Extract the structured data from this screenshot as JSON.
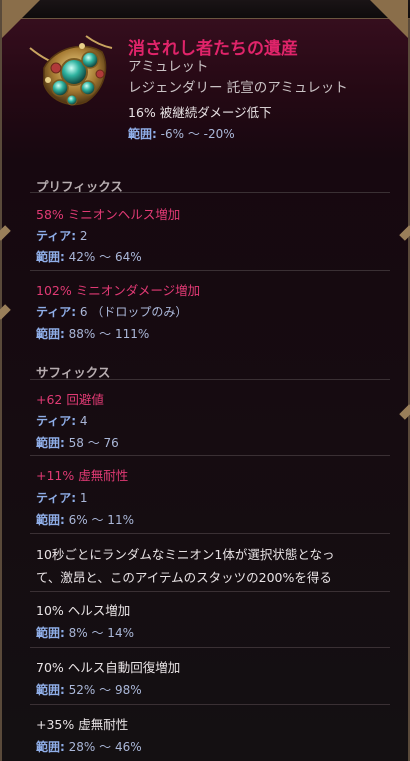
{
  "item": {
    "name": "消されし者たちの遺産",
    "type": "アミュレット",
    "rarity_line": "レジェンダリー 託宣のアミュレット",
    "implicit": {
      "text": "16% 被継続ダメージ低下",
      "range_label": "範囲:",
      "range_value": "-6% 〜 -20%"
    }
  },
  "prefix_section": {
    "title": "プリフィックス",
    "mods": [
      {
        "name": "58% ミニオンヘルス増加",
        "tier_label": "ティア:",
        "tier_value": "2",
        "range_label": "範囲:",
        "range_value": "42% 〜 64%"
      },
      {
        "name": "102% ミニオンダメージ増加",
        "tier_label": "ティア:",
        "tier_value": "6 （ドロップのみ）",
        "range_label": "範囲:",
        "range_value": "88% 〜 111%"
      }
    ]
  },
  "suffix_section": {
    "title": "サフィックス",
    "mods": [
      {
        "name": "+62 回避値",
        "tier_label": "ティア:",
        "tier_value": "4",
        "range_label": "範囲:",
        "range_value": "58 〜 76"
      },
      {
        "name": "+11% 虚無耐性",
        "tier_label": "ティア:",
        "tier_value": "1",
        "range_label": "範囲:",
        "range_value": "6% 〜 11%"
      }
    ]
  },
  "unique_effects": {
    "description_line1": "10秒ごとにランダムなミニオン1体が選択状態となっ",
    "description_line2": "て、激昂と、このアイテムのスタッツの200%を得る",
    "stats": [
      {
        "text": "10% ヘルス増加",
        "range_label": "範囲:",
        "range_value": "8% 〜 14%"
      },
      {
        "text": "70% ヘルス自動回復増加",
        "range_label": "範囲:",
        "range_value": "52% 〜 98%"
      },
      {
        "text": "+35% 虚無耐性",
        "range_label": "範囲:",
        "range_value": "28% 〜 46%"
      }
    ]
  },
  "colors": {
    "title": "#e0246a",
    "affix_name": "#e03a74",
    "label": "#8faee8",
    "background": "#170810"
  },
  "icons": {
    "item_image": "legendary-amulet-icon"
  }
}
